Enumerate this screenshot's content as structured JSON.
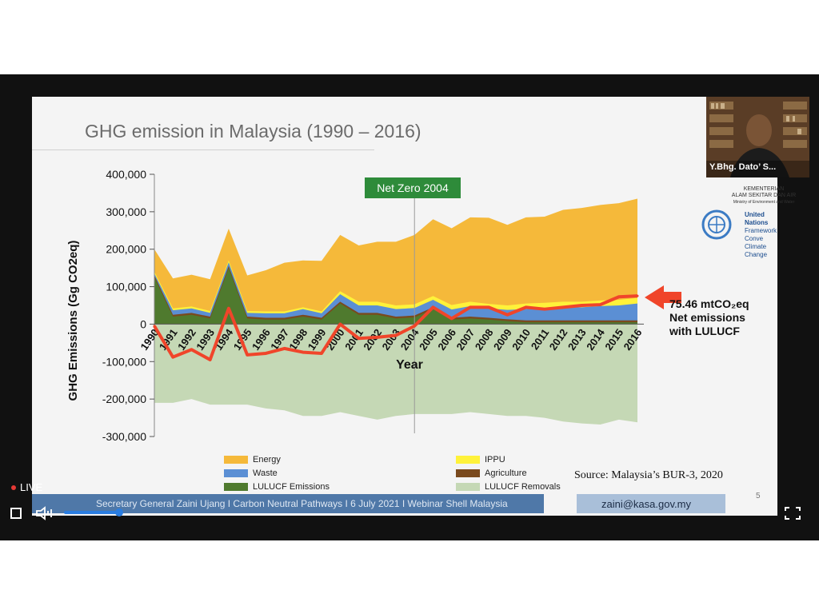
{
  "slide": {
    "title": "GHG emission in Malaysia (1990 – 2016)",
    "net_zero_label": "Net Zero 2004",
    "annotation": [
      "75.46 mtCO₂eq",
      "Net emissions",
      "with LULUCF"
    ],
    "source": "Source: Malaysia’s BUR-3, 2020",
    "page_number": "5",
    "footer_text": "Secretary General Zaini Ujang I Carbon Neutral Pathways I 6 July 2021 I Webinar Shell Malaysia",
    "footer_email": "zaini@kasa.gov.my",
    "ministry": [
      "KEMENTERIAN",
      "ALAM SEKITAR DAN AIR",
      "Ministry of Environment and Water"
    ],
    "un_text": [
      "United Nations",
      "Framework Conve",
      "Climate Change"
    ]
  },
  "webcam": {
    "name": "Y.Bhg. Dato’ S..."
  },
  "player": {
    "live_label": "LIVE",
    "progress": 1.0
  },
  "colors": {
    "energy": "#f5b93a",
    "ippu": "#fff23a",
    "waste": "#5b8fd4",
    "agriculture": "#7a4a1e",
    "lulucf_emissions": "#4f7a2e",
    "lulucf_removals": "#c5d8b5",
    "net_line": "#f0452a",
    "net_zero": "#2e8b3a"
  },
  "chart_data": {
    "type": "area",
    "title": "",
    "xlabel": "Year",
    "ylabel": "GHG Emissions (Gg CO2eq)",
    "ylim": [
      -300000,
      400000
    ],
    "yticks": [
      "400,000",
      "300,000",
      "200,000",
      "100,000",
      "0",
      "-100,000",
      "-200,000",
      "-300,000"
    ],
    "ytick_values": [
      400000,
      300000,
      200000,
      100000,
      0,
      -100000,
      -200000,
      -300000
    ],
    "x": [
      "1990",
      "1991",
      "1992",
      "1993",
      "1994",
      "1995",
      "1996",
      "1997",
      "1998",
      "1999",
      "2000",
      "2001",
      "2002",
      "2003",
      "2004",
      "2005",
      "2006",
      "2007",
      "2008",
      "2009",
      "2010",
      "2011",
      "2012",
      "2013",
      "2014",
      "2015",
      "2016"
    ],
    "series": [
      {
        "name": "LULUCF  Emissions",
        "values": [
          125000,
          20000,
          25000,
          15000,
          150000,
          15000,
          12000,
          12000,
          20000,
          12000,
          55000,
          25000,
          25000,
          15000,
          18000,
          40000,
          12000,
          15000,
          12000,
          8000,
          5000,
          5000,
          5000,
          5000,
          5000,
          5000,
          5000
        ]
      },
      {
        "name": "Agriculture",
        "values": [
          5000,
          5000,
          5000,
          5000,
          5000,
          5000,
          5000,
          5000,
          5000,
          5000,
          5000,
          5000,
          5000,
          5000,
          5000,
          5000,
          5000,
          5000,
          5000,
          5000,
          5000,
          5000,
          5000,
          5000,
          5000,
          5000,
          5000
        ]
      },
      {
        "name": "Waste",
        "values": [
          5000,
          12000,
          12000,
          10000,
          10000,
          10000,
          12000,
          12000,
          15000,
          12000,
          20000,
          20000,
          20000,
          20000,
          20000,
          20000,
          22000,
          28000,
          25000,
          25000,
          30000,
          32000,
          35000,
          35000,
          38000,
          40000,
          45000
        ]
      },
      {
        "name": "IPPU",
        "values": [
          5000,
          5000,
          5000,
          5000,
          5000,
          5000,
          5000,
          5000,
          5000,
          5000,
          8000,
          10000,
          10000,
          10000,
          10000,
          10000,
          12000,
          12000,
          12000,
          12000,
          15000,
          15000,
          15000,
          15000,
          15000,
          15000,
          15000
        ]
      },
      {
        "name": "Energy",
        "values": [
          60000,
          80000,
          85000,
          85000,
          85000,
          95000,
          110000,
          130000,
          125000,
          135000,
          150000,
          150000,
          160000,
          170000,
          185000,
          205000,
          205000,
          225000,
          230000,
          215000,
          230000,
          230000,
          245000,
          250000,
          255000,
          258000,
          265000
        ]
      },
      {
        "name": "LULUCF  Removals",
        "values": [
          -210000,
          -210000,
          -200000,
          -215000,
          -215000,
          -215000,
          -225000,
          -230000,
          -245000,
          -245000,
          -235000,
          -245000,
          -255000,
          -245000,
          -240000,
          -240000,
          -240000,
          -235000,
          -240000,
          -245000,
          -245000,
          -250000,
          -260000,
          -265000,
          -268000,
          -255000,
          -262000
        ]
      }
    ],
    "net_emissions": {
      "name": "Net emissions with LULUCF",
      "values": [
        -5000,
        -88000,
        -68000,
        -95000,
        42000,
        -82000,
        -78000,
        -65000,
        -75000,
        -78000,
        0,
        -38000,
        -35000,
        -30000,
        -5000,
        45000,
        15000,
        45000,
        45000,
        25000,
        45000,
        40000,
        45000,
        50000,
        52000,
        73000,
        75460
      ]
    },
    "net_zero_year": "2004",
    "legend": [
      {
        "label": "Energy",
        "key": "energy"
      },
      {
        "label": "IPPU",
        "key": "ippu"
      },
      {
        "label": "Waste",
        "key": "waste"
      },
      {
        "label": "Agriculture",
        "key": "agriculture"
      },
      {
        "label": "LULUCF  Emissions",
        "key": "lulucf_emissions"
      },
      {
        "label": "LULUCF  Removals",
        "key": "lulucf_removals"
      }
    ],
    "legend_position": "bottom",
    "grid": false
  }
}
